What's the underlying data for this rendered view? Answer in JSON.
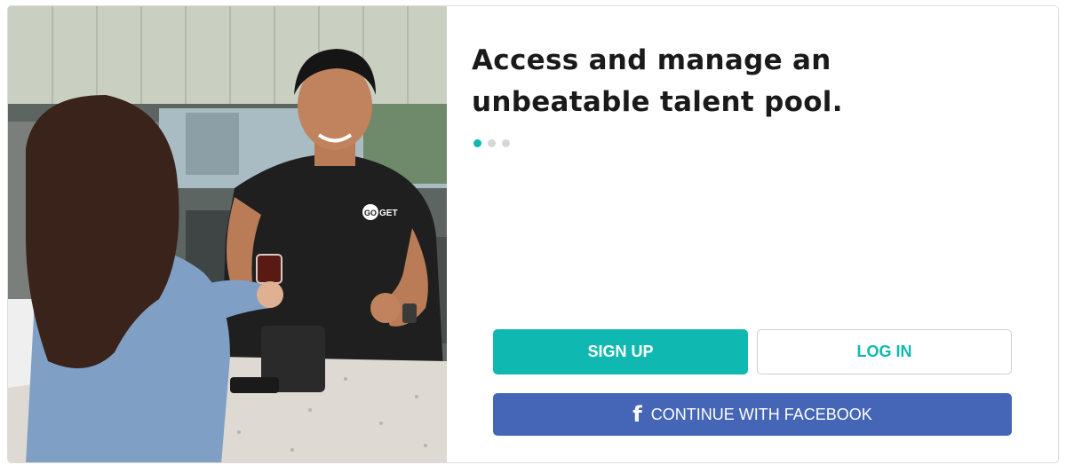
{
  "photo": {
    "shirt_logo": "GO GET"
  },
  "hero": {
    "headline": "Access and manage an unbeatable talent pool.",
    "carousel_total": 3,
    "carousel_active": 1
  },
  "actions": {
    "signup_label": "SIGN UP",
    "login_label": "LOG IN",
    "facebook_label": "CONTINUE WITH FACEBOOK",
    "facebook_icon": "f"
  },
  "colors": {
    "accent": "#0fb9b1",
    "facebook": "#4566b7",
    "text": "#1a1a1a"
  }
}
